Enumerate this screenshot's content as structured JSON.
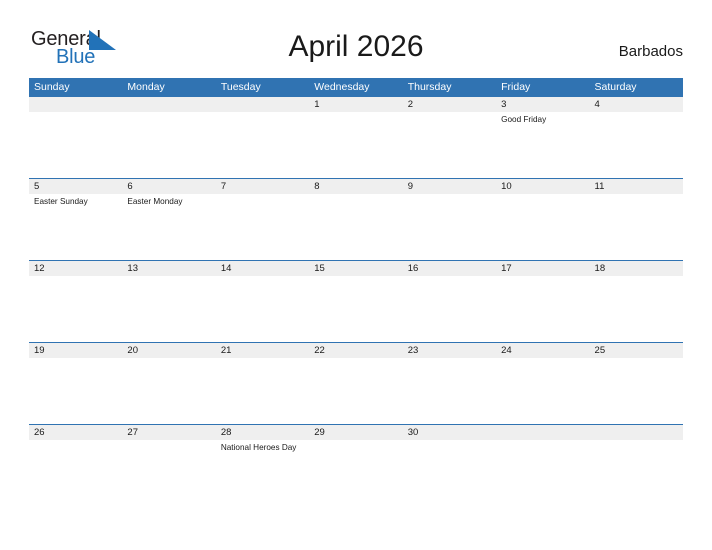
{
  "logo": {
    "word1": "General",
    "word2": "Blue",
    "triangle_icon": "triangle-icon",
    "color_dark": "#231f20",
    "color_blue": "#2272b8"
  },
  "header": {
    "title": "April 2026",
    "country": "Barbados"
  },
  "theme": {
    "header_blue": "#3073b2",
    "row_gray": "#efefef",
    "text": "#1a1a1a",
    "page_bg": "#ffffff"
  },
  "calendar": {
    "month": "April",
    "year": "2026",
    "day_headers": [
      "Sunday",
      "Monday",
      "Tuesday",
      "Wednesday",
      "Thursday",
      "Friday",
      "Saturday"
    ],
    "weeks": [
      {
        "separator": false,
        "days": [
          {
            "number": "",
            "event": ""
          },
          {
            "number": "",
            "event": ""
          },
          {
            "number": "",
            "event": ""
          },
          {
            "number": "1",
            "event": ""
          },
          {
            "number": "2",
            "event": ""
          },
          {
            "number": "3",
            "event": "Good Friday"
          },
          {
            "number": "4",
            "event": ""
          }
        ]
      },
      {
        "separator": true,
        "days": [
          {
            "number": "5",
            "event": "Easter Sunday"
          },
          {
            "number": "6",
            "event": "Easter Monday"
          },
          {
            "number": "7",
            "event": ""
          },
          {
            "number": "8",
            "event": ""
          },
          {
            "number": "9",
            "event": ""
          },
          {
            "number": "10",
            "event": ""
          },
          {
            "number": "11",
            "event": ""
          }
        ]
      },
      {
        "separator": true,
        "days": [
          {
            "number": "12",
            "event": ""
          },
          {
            "number": "13",
            "event": ""
          },
          {
            "number": "14",
            "event": ""
          },
          {
            "number": "15",
            "event": ""
          },
          {
            "number": "16",
            "event": ""
          },
          {
            "number": "17",
            "event": ""
          },
          {
            "number": "18",
            "event": ""
          }
        ]
      },
      {
        "separator": true,
        "days": [
          {
            "number": "19",
            "event": ""
          },
          {
            "number": "20",
            "event": ""
          },
          {
            "number": "21",
            "event": ""
          },
          {
            "number": "22",
            "event": ""
          },
          {
            "number": "23",
            "event": ""
          },
          {
            "number": "24",
            "event": ""
          },
          {
            "number": "25",
            "event": ""
          }
        ]
      },
      {
        "separator": true,
        "days": [
          {
            "number": "26",
            "event": ""
          },
          {
            "number": "27",
            "event": ""
          },
          {
            "number": "28",
            "event": "National Heroes Day"
          },
          {
            "number": "29",
            "event": ""
          },
          {
            "number": "30",
            "event": ""
          },
          {
            "number": "",
            "event": ""
          },
          {
            "number": "",
            "event": ""
          }
        ]
      }
    ]
  }
}
